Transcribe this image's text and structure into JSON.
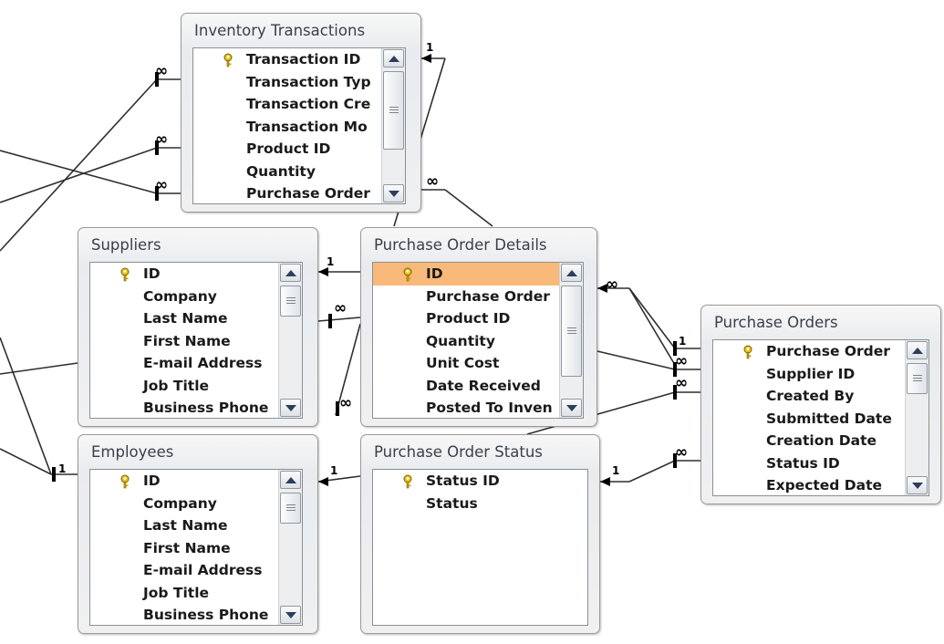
{
  "tables": {
    "inventory_transactions": {
      "title": "Inventory Transactions",
      "fields": [
        "Transaction ID",
        "Transaction Typ",
        "Transaction Cre",
        "Transaction Mo",
        "Product ID",
        "Quantity",
        "Purchase Order"
      ]
    },
    "suppliers": {
      "title": "Suppliers",
      "fields": [
        "ID",
        "Company",
        "Last Name",
        "First Name",
        "E-mail Address",
        "Job Title",
        "Business Phone"
      ]
    },
    "purchase_order_details": {
      "title": "Purchase Order Details",
      "fields": [
        "ID",
        "Purchase Order",
        "Product ID",
        "Quantity",
        "Unit Cost",
        "Date Received",
        "Posted To Inven"
      ]
    },
    "purchase_orders": {
      "title": "Purchase Orders",
      "fields": [
        "Purchase Order",
        "Supplier ID",
        "Created By",
        "Submitted Date",
        "Creation Date",
        "Status ID",
        "Expected Date"
      ]
    },
    "employees": {
      "title": "Employees",
      "fields": [
        "ID",
        "Company",
        "Last Name",
        "First Name",
        "E-mail Address",
        "Job Title",
        "Business Phone"
      ]
    },
    "purchase_order_status": {
      "title": "Purchase Order Status",
      "fields": [
        "Status ID",
        "Status"
      ]
    }
  },
  "cardinality": {
    "one": "1",
    "many": "∞"
  },
  "colors": {
    "selected_row": "#f9b97a",
    "line": "#2f2f2f",
    "key_icon": "#d9b400"
  }
}
